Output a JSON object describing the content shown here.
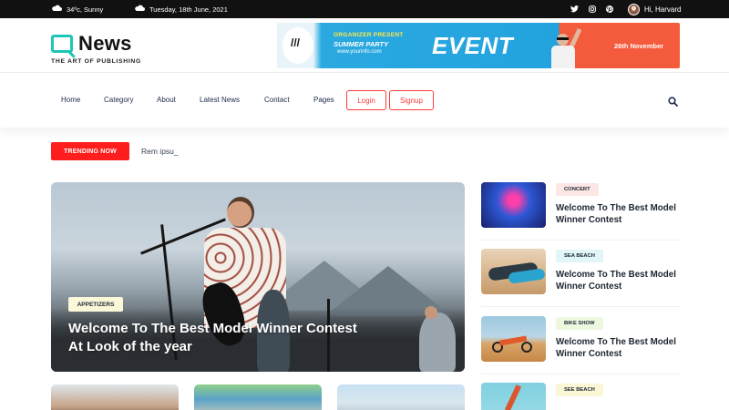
{
  "topbar": {
    "weather": "34ºc, Sunny",
    "date": "Tuesday, 18th June, 2021",
    "social_icons": [
      "twitter-icon",
      "instagram-icon",
      "pinterest-icon"
    ],
    "user_greeting": "Hi, Harvard"
  },
  "header": {
    "logo_name": "News",
    "logo_tagline": "THE ART OF PUBLISHING",
    "banner": {
      "organizer": "ORGANIZER PRESENT",
      "subtitle": "SUMMER PARTY",
      "url": "www.yourinfo.com",
      "headline": "EVENT",
      "date": "26th November"
    }
  },
  "nav": {
    "links": [
      "Home",
      "Category",
      "About",
      "Latest News",
      "Contact",
      "Pages"
    ],
    "login_label": "Login",
    "signup_label": "Signup"
  },
  "trending": {
    "label": "TRENDING NOW",
    "text": "Rem ipsu_"
  },
  "featured": {
    "badge": "APPETIZERS",
    "title": "Welcome To The Best Model Winner Contest At Look of the year"
  },
  "side_list": [
    {
      "badge": "CONCERT",
      "title": "Welcome To The Best Model Winner Contest"
    },
    {
      "badge": "SEA BEACH",
      "title": "Welcome To The Best Model Winner Contest"
    },
    {
      "badge": "BIKE SHOW",
      "title": "Welcome To The Best Model Winner Contest"
    },
    {
      "badge": "SEE BEACH",
      "title": ""
    }
  ],
  "colors": {
    "accent_red": "#ff1e1e",
    "brand_teal": "#1ec6b6",
    "topbar_bg": "#111111",
    "text_dark": "#1d2733"
  }
}
